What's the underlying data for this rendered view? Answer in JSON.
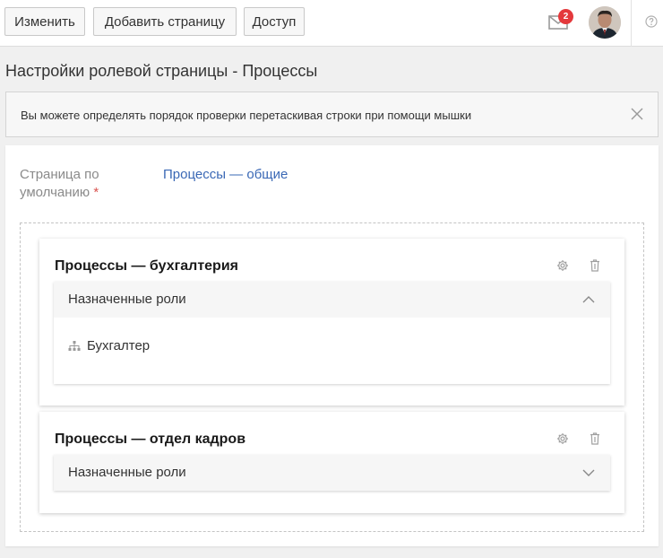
{
  "toolbar": {
    "edit_label": "Изменить",
    "add_page_label": "Добавить страницу",
    "access_label": "Доступ",
    "notifications_count": "2"
  },
  "page": {
    "title": "Настройки ролевой страницы - Процессы"
  },
  "alert": {
    "text": "Вы можете определять порядок проверки перетаскивая строки при помощи мышки"
  },
  "default_page": {
    "label": "Страница по умолчанию",
    "required_mark": "*",
    "value": "Процессы — общие"
  },
  "role_pages": [
    {
      "title": "Процессы — бухгалтерия",
      "section_label": "Назначенные роли",
      "expanded": true,
      "roles": [
        "Бухгалтер"
      ]
    },
    {
      "title": "Процессы — отдел кадров",
      "section_label": "Назначенные роли",
      "expanded": false,
      "roles": []
    }
  ],
  "colors": {
    "link": "#3a68b5",
    "badge": "#e4393c",
    "required": "#d9534f"
  }
}
